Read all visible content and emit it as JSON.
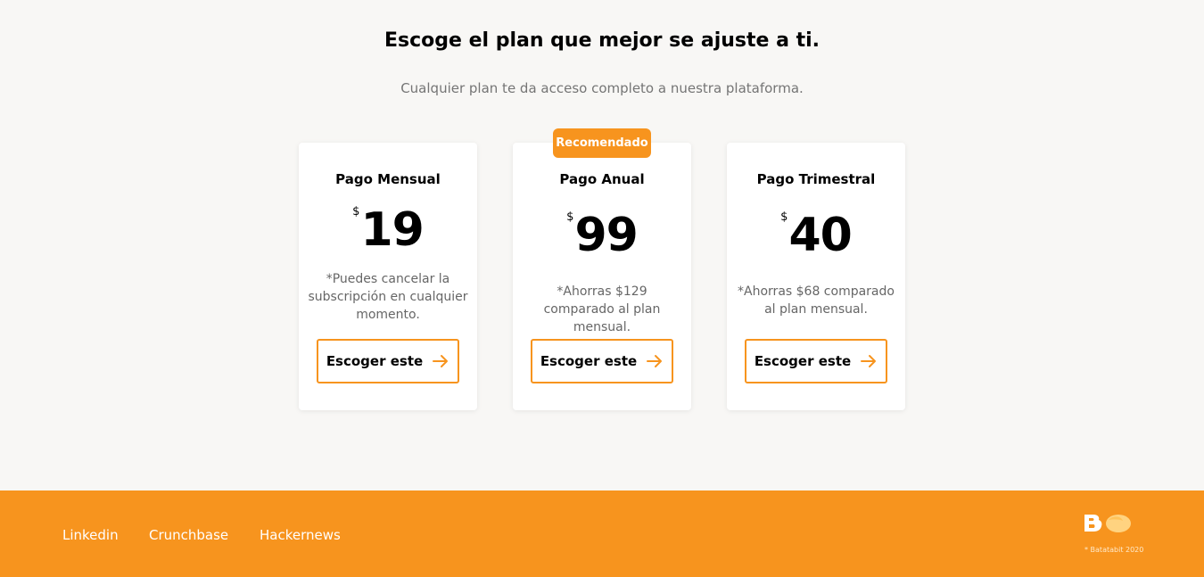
{
  "pricing": {
    "title": "Escoge el plan que mejor se ajuste a ti.",
    "subtitle": "Cualquier plan te da acceso completo a nuestra plataforma.",
    "recommended_badge": "Recomendado",
    "plans": [
      {
        "name": "Pago Mensual",
        "currency": "$",
        "amount": "19",
        "note": "*Puedes cancelar la subscripción en cualquier momento.",
        "button_label": "Escoger este",
        "button_icon": "arrow-right-icon"
      },
      {
        "name": "Pago Anual",
        "currency": "$",
        "amount": "99",
        "note": "*Ahorras $129 comparado al plan mensual.",
        "button_label": "Escoger este",
        "button_icon": "arrow-right-icon"
      },
      {
        "name": "Pago Trimestral",
        "currency": "$",
        "amount": "40",
        "note": "*Ahorras $68 comparado al plan mensual.",
        "button_label": "Escoger este",
        "button_icon": "arrow-right-icon"
      }
    ]
  },
  "footer": {
    "links": [
      "Linkedin",
      "Crunchbase",
      "Hackernews"
    ],
    "logo_icon": "batatabit-logo",
    "copyright": "* Batatabit 2020"
  },
  "colors": {
    "accent": "#f7941e",
    "background": "#f8f7f5",
    "card": "#ffffff",
    "muted_text": "#757575"
  }
}
